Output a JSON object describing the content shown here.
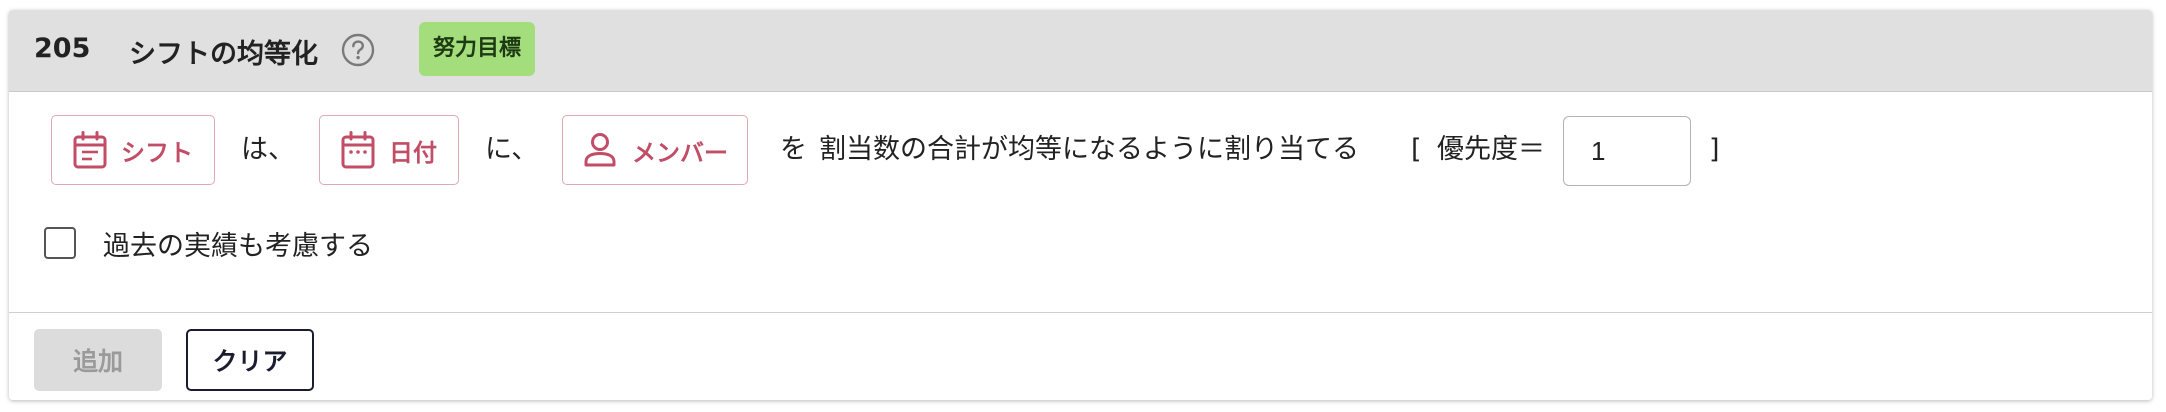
{
  "header": {
    "rule_number": "205",
    "rule_title": "シフトの均等化",
    "help_icon": "question-circle-icon",
    "tag_label": "努力目標",
    "tag_color": "#a3dd7c"
  },
  "rule": {
    "chips": [
      {
        "label": "シフト",
        "icon": "calendar-list-icon"
      },
      {
        "label": "日付",
        "icon": "calendar-icon"
      },
      {
        "label": "メンバー",
        "icon": "person-icon"
      }
    ],
    "particle_1": "は、",
    "particle_2": "に、",
    "particle_3": "を",
    "description": "割当数の合計が均等になるように割り当てる",
    "bracket_open": "[",
    "priority_label": "優先度＝",
    "priority_value": "1",
    "bracket_close": "]",
    "chip_color": "#c14d66"
  },
  "options": {
    "consider_past_label": "過去の実績も考慮する",
    "consider_past_checked": false
  },
  "footer": {
    "add_label": "追加",
    "add_disabled": true,
    "clear_label": "クリア"
  }
}
